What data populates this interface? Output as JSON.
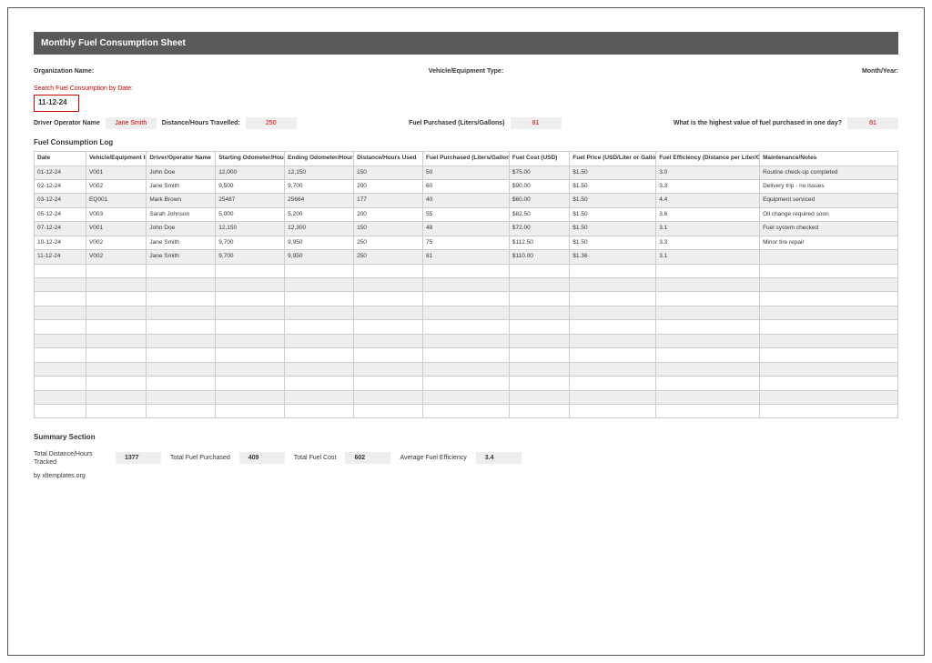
{
  "title": "Monthly Fuel Consumption Sheet",
  "org": {
    "name_label": "Organization Name:",
    "type_label": "Vehicle/Equipment Type:",
    "month_label": "Month/Year:"
  },
  "search": {
    "label": "Search Fuel Consumption by Date:",
    "value": "11-12-24"
  },
  "lookup": {
    "driver_label": "Driver Operator Name",
    "driver_value": "Jane Smith",
    "dist_label": "Distance/Hours Travelled:",
    "dist_value": "250",
    "fuel_label": "Fuel Purchased (Liters/Gallons)",
    "fuel_value": "81",
    "question": "What is the highest value of fuel purchased in one day?",
    "answer": "81"
  },
  "log_header": "Fuel Consumption Log",
  "cols": [
    "Date",
    "Vehicle/Equipment ID",
    "Driver/Operator Name",
    "Starting Odometer/Hours",
    "Ending Odometer/Hours",
    "Distance/Hours Used",
    "Fuel Purchased (Liters/Gallons)",
    "Fuel Cost (USD)",
    "Fuel Price (USD/Liter or Gallon)",
    "Fuel Efficiency (Distance per Liter/Gallon)",
    "Maintenance/Notes"
  ],
  "rows": [
    [
      "01-12-24",
      "V001",
      "John Doe",
      "12,000",
      "12,150",
      "150",
      "50",
      "$75.00",
      "$1.50",
      "3.0",
      "Routine check-up completed"
    ],
    [
      "02-12-24",
      "V002",
      "Jane Smith",
      "9,500",
      "9,700",
      "200",
      "60",
      "$90.00",
      "$1.50",
      "3.3",
      "Delivery trip - no issues"
    ],
    [
      "03-12-24",
      "EQ001",
      "Mark Brown",
      "25487",
      "25664",
      "177",
      "40",
      "$60.00",
      "$1.50",
      "4.4",
      "Equipment serviced"
    ],
    [
      "05-12-24",
      "V003",
      "Sarah Johnson",
      "5,000",
      "5,200",
      "200",
      "55",
      "$82.50",
      "$1.50",
      "3.6",
      "Oil change required soon"
    ],
    [
      "07-12-24",
      "V001",
      "John Doe",
      "12,150",
      "12,300",
      "150",
      "48",
      "$72.00",
      "$1.50",
      "3.1",
      "Fuel system checked"
    ],
    [
      "10-12-24",
      "V002",
      "Jane Smith",
      "9,700",
      "9,950",
      "250",
      "75",
      "$112.50",
      "$1.50",
      "3.3",
      "Minor tire repair"
    ],
    [
      "11-12-24",
      "V002",
      "Jane Smith",
      "9,700",
      "9,950",
      "250",
      "81",
      "$110.00",
      "$1.36",
      "3.1",
      ""
    ]
  ],
  "empty_rows": 11,
  "summary_header": "Summary Section",
  "summary": [
    {
      "label": "Total Distance/Hours Tracked",
      "value": "1377"
    },
    {
      "label": "Total Fuel Purchased",
      "value": "409"
    },
    {
      "label": "Total Fuel Cost",
      "value": "602"
    },
    {
      "label": "Average Fuel Efficiency",
      "value": "3.4"
    }
  ],
  "credit": "by  xltemplates.org"
}
